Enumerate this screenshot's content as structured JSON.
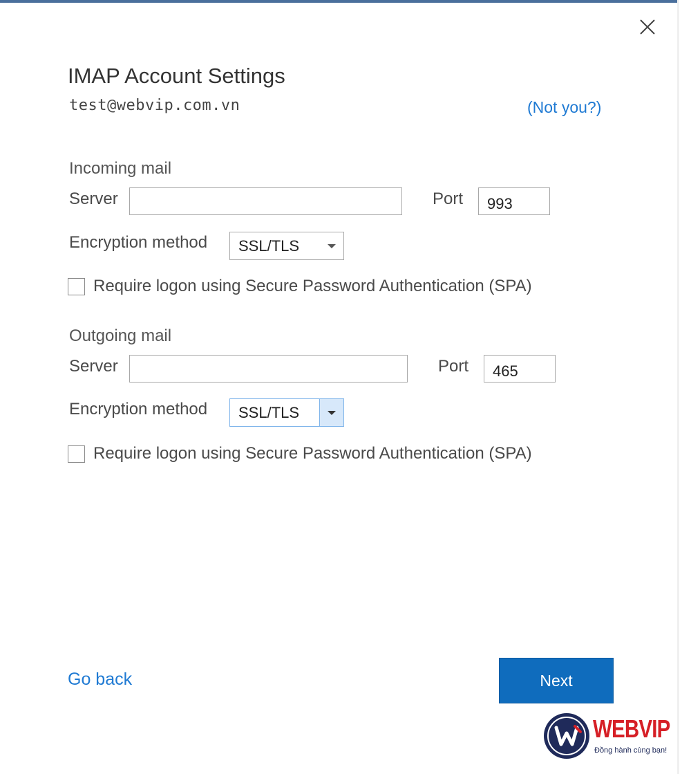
{
  "dialog": {
    "title": "IMAP Account Settings",
    "email": "test@webvip.com.vn",
    "not_you_link": "(Not you?)"
  },
  "incoming": {
    "section_title": "Incoming mail",
    "server_label": "Server",
    "server_value": "",
    "port_label": "Port",
    "port_value": "993",
    "encryption_label": "Encryption method",
    "encryption_value": "SSL/TLS",
    "spa_label": "Require logon using Secure Password Authentication (SPA)",
    "spa_checked": false
  },
  "outgoing": {
    "section_title": "Outgoing mail",
    "server_label": "Server",
    "server_value": "",
    "port_label": "Port",
    "port_value": "465",
    "encryption_label": "Encryption method",
    "encryption_value": "SSL/TLS",
    "spa_label": "Require logon using Secure Password Authentication (SPA)",
    "spa_checked": false
  },
  "footer": {
    "go_back_label": "Go back",
    "next_label": "Next"
  },
  "watermark": {
    "brand": "WEBVIP",
    "slogan": "Đồng hành cùng bạn!"
  },
  "colors": {
    "accent": "#0f6cbd",
    "link": "#1f7ad3",
    "brand_red": "#d61f26",
    "brand_navy": "#1f2a5a"
  },
  "icons": {
    "close": "close-icon",
    "dropdown": "chevron-down-icon"
  }
}
